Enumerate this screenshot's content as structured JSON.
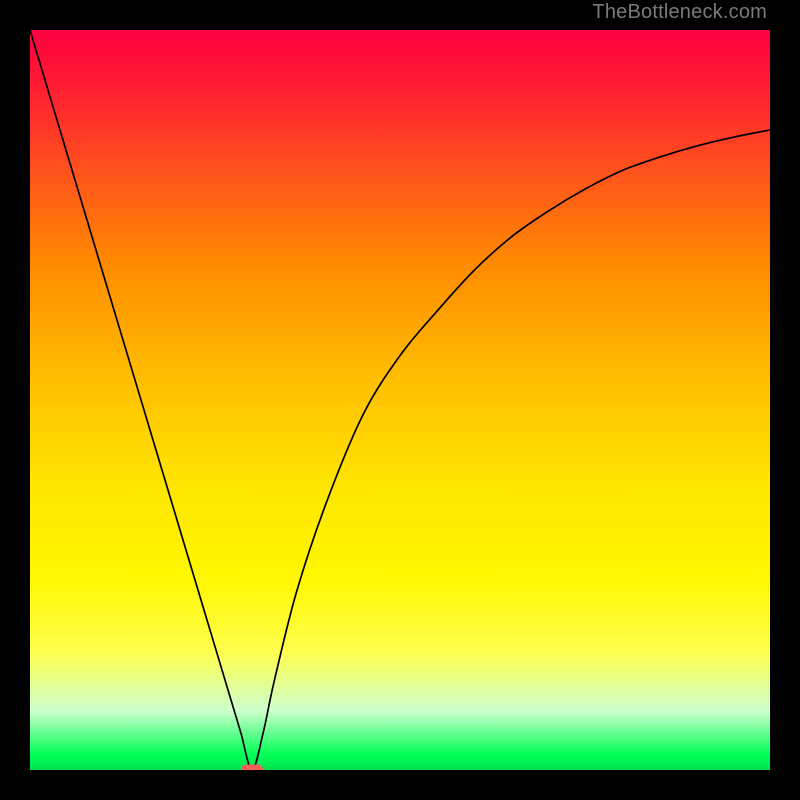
{
  "watermark": "TheBottleneck.com",
  "chart_data": {
    "type": "line",
    "title": "",
    "xlabel": "",
    "ylabel": "",
    "xlim": [
      0,
      100
    ],
    "ylim": [
      0,
      100
    ],
    "grid": false,
    "series": [
      {
        "name": "bottleneck-curve",
        "x": [
          0,
          3,
          6,
          9,
          12,
          15,
          18,
          21,
          24,
          27,
          28.5,
          30,
          31.5,
          33,
          36,
          40,
          45,
          50,
          55,
          60,
          65,
          70,
          75,
          80,
          85,
          90,
          95,
          100
        ],
        "y": [
          100,
          90,
          80,
          70,
          60,
          50,
          40,
          30,
          20,
          10,
          5,
          0,
          5,
          12,
          24,
          36,
          48,
          56,
          62,
          67.5,
          72,
          75.5,
          78.5,
          81,
          82.8,
          84.3,
          85.5,
          86.5
        ]
      }
    ],
    "marker": {
      "x": 30,
      "y": 0
    },
    "colors": {
      "curve": "#000000",
      "marker": "#ff5d5d",
      "gradient_top": "#ff0040",
      "gradient_mid": "#ffd000",
      "gradient_bottom": "#00e04f"
    }
  }
}
